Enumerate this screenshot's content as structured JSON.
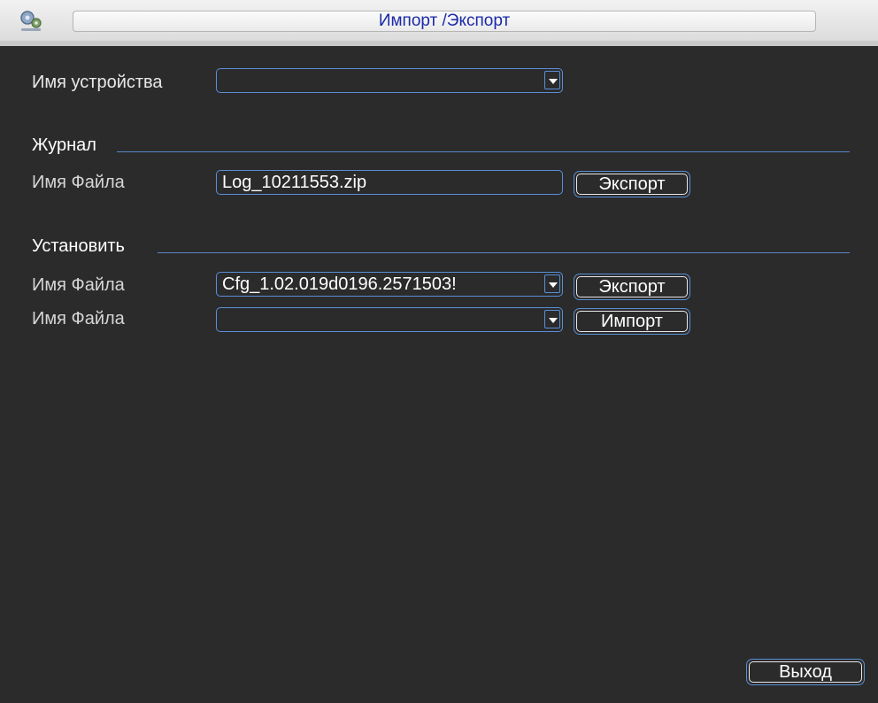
{
  "window": {
    "title": "Импорт /Экспорт",
    "icon": "settings-gear-icon"
  },
  "device": {
    "label": "Имя устройства",
    "value": ""
  },
  "log_section": {
    "heading": "Журнал",
    "file_label": "Имя Файла",
    "file_value": "Log_10211553.zip",
    "export_label": "Экспорт"
  },
  "config_section": {
    "heading": "Установить",
    "export_row": {
      "file_label": "Имя Файла",
      "file_value": "Cfg_1.02.019d0196.2571503!",
      "button_label": "Экспорт"
    },
    "import_row": {
      "file_label": "Имя Файла",
      "file_value": "",
      "button_label": "Импорт"
    }
  },
  "footer": {
    "exit_label": "Выход"
  },
  "colors": {
    "background": "#2b2b2b",
    "accent": "#5a8fd8",
    "title_text": "#1a2aa8"
  }
}
